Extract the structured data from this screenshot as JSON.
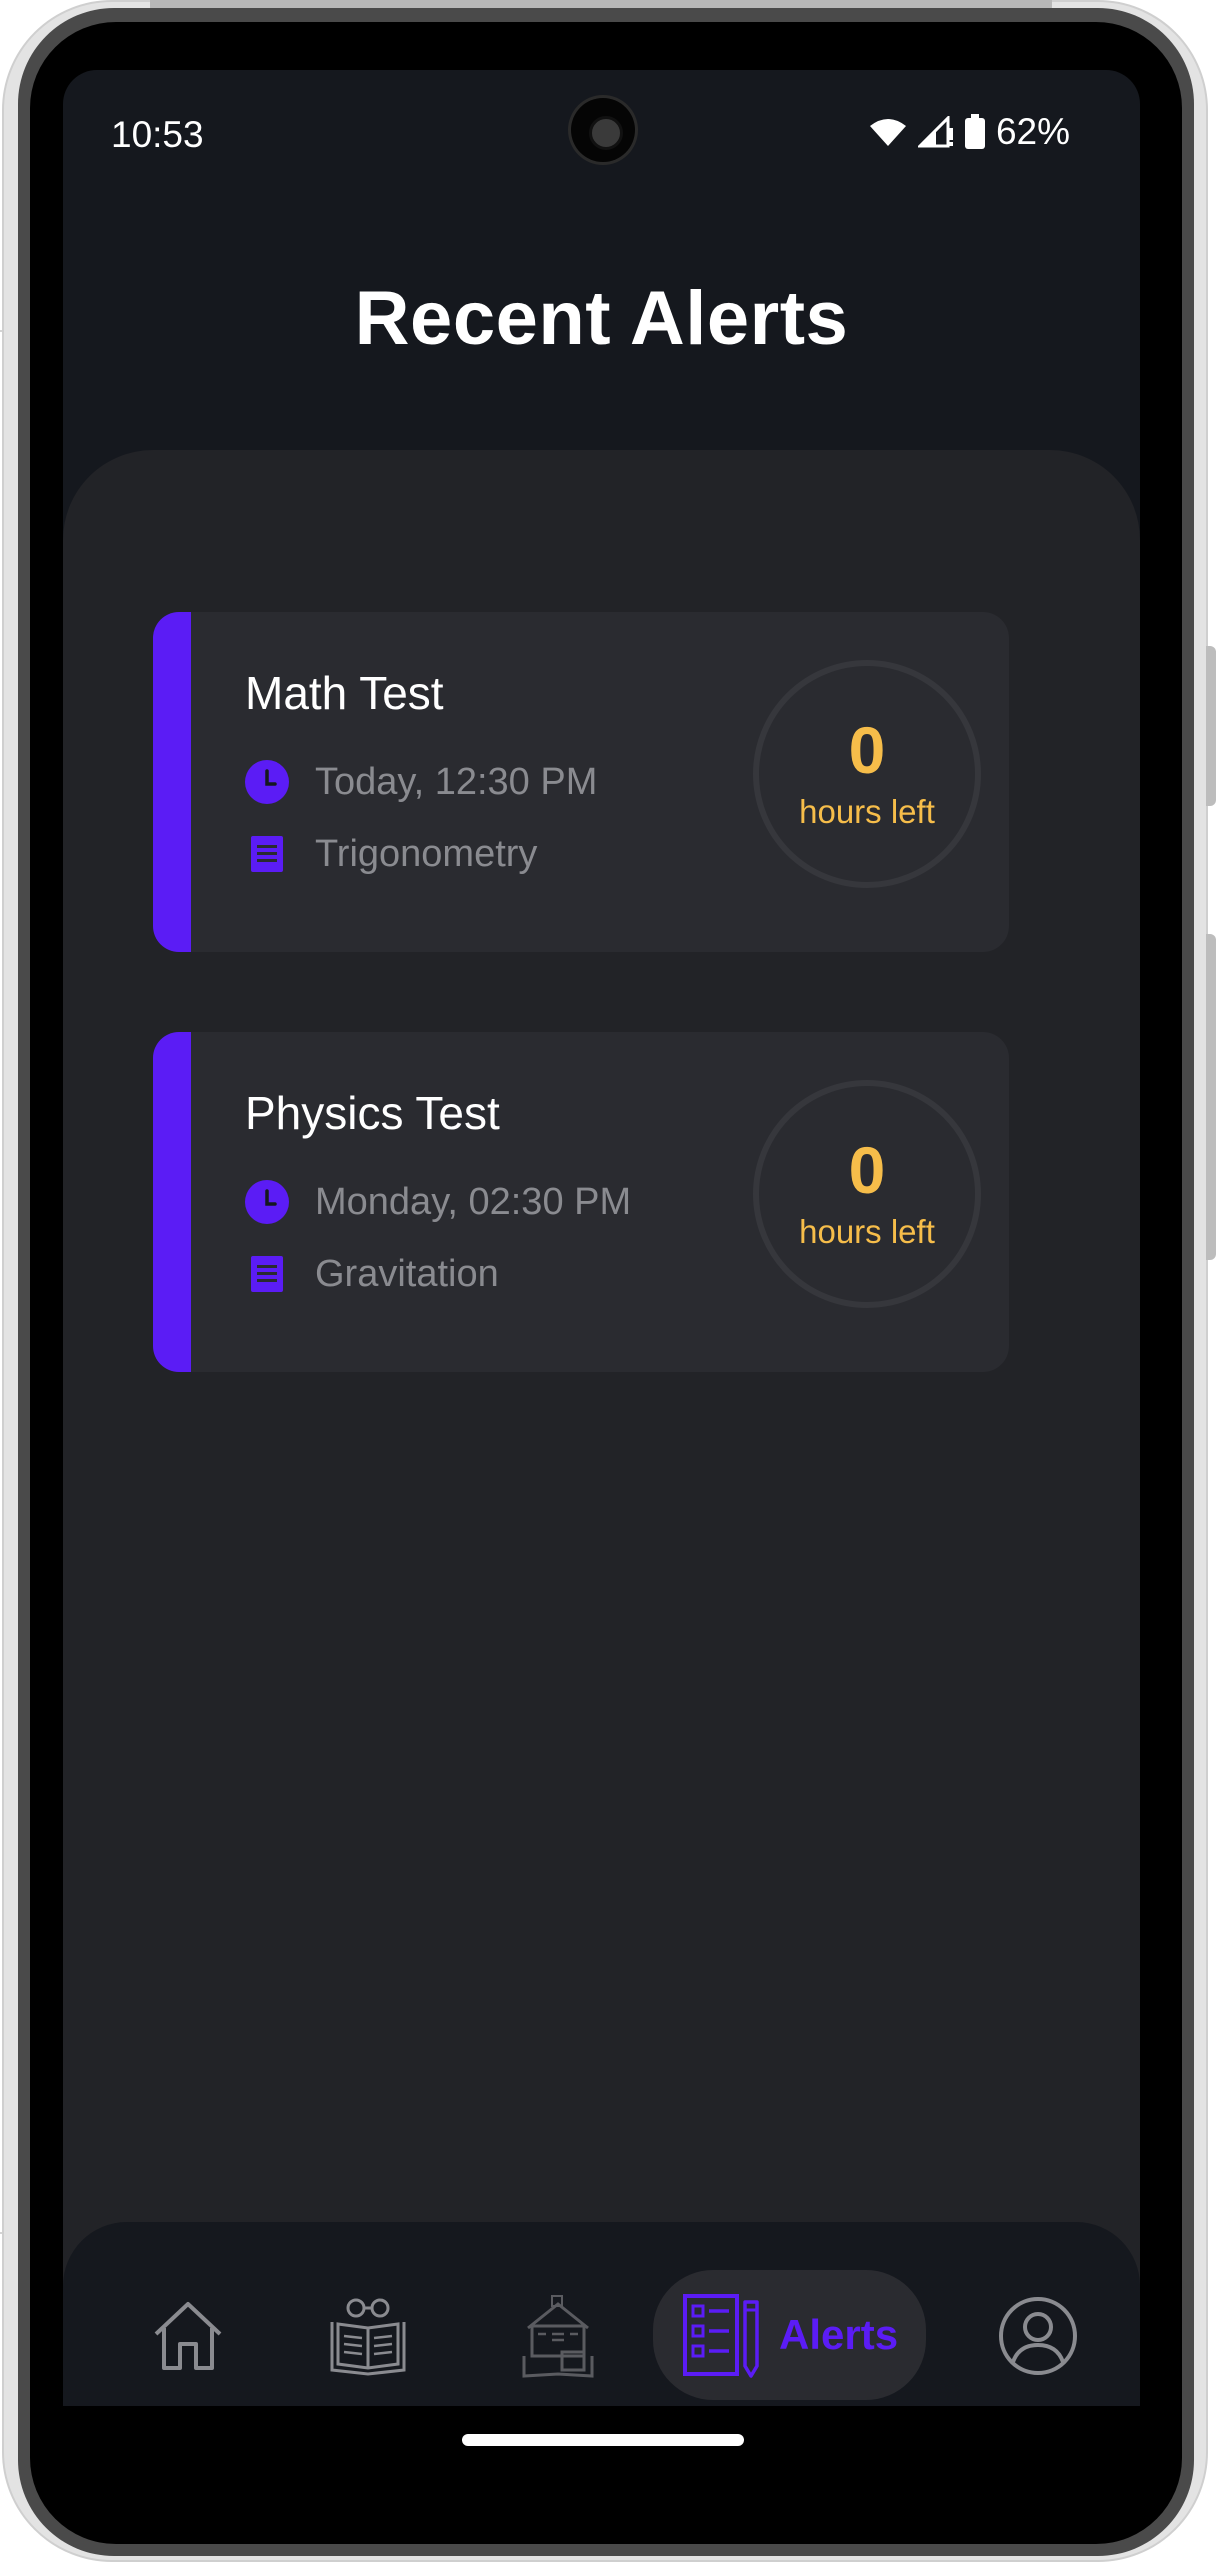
{
  "status_bar": {
    "time": "10:53",
    "battery_percent": "62%",
    "icons": [
      "wifi-icon",
      "cellular-signal-icon",
      "battery-icon"
    ]
  },
  "page": {
    "title": "Recent Alerts"
  },
  "alerts": [
    {
      "title": "Math Test",
      "datetime": "Today, 12:30 PM",
      "topic": "Trigonometry",
      "countdown_value": "0",
      "countdown_label": "hours left"
    },
    {
      "title": "Physics Test",
      "datetime": "Monday, 02:30 PM",
      "topic": "Gravitation",
      "countdown_value": "0",
      "countdown_label": "hours left"
    }
  ],
  "bottom_nav": {
    "items": [
      {
        "icon": "home-icon",
        "active": false
      },
      {
        "icon": "reading-book-icon",
        "active": false
      },
      {
        "icon": "school-building-icon",
        "active": false
      },
      {
        "icon": "checklist-pencil-icon",
        "label": "Alerts",
        "active": true
      },
      {
        "icon": "user-profile-icon",
        "active": false
      }
    ]
  },
  "colors": {
    "accent": "#5b1cf5",
    "countdown": "#f6bd4a",
    "background": "#15181e",
    "panel": "#222327",
    "card": "#2a2b30",
    "muted_text": "#8a8b90"
  }
}
